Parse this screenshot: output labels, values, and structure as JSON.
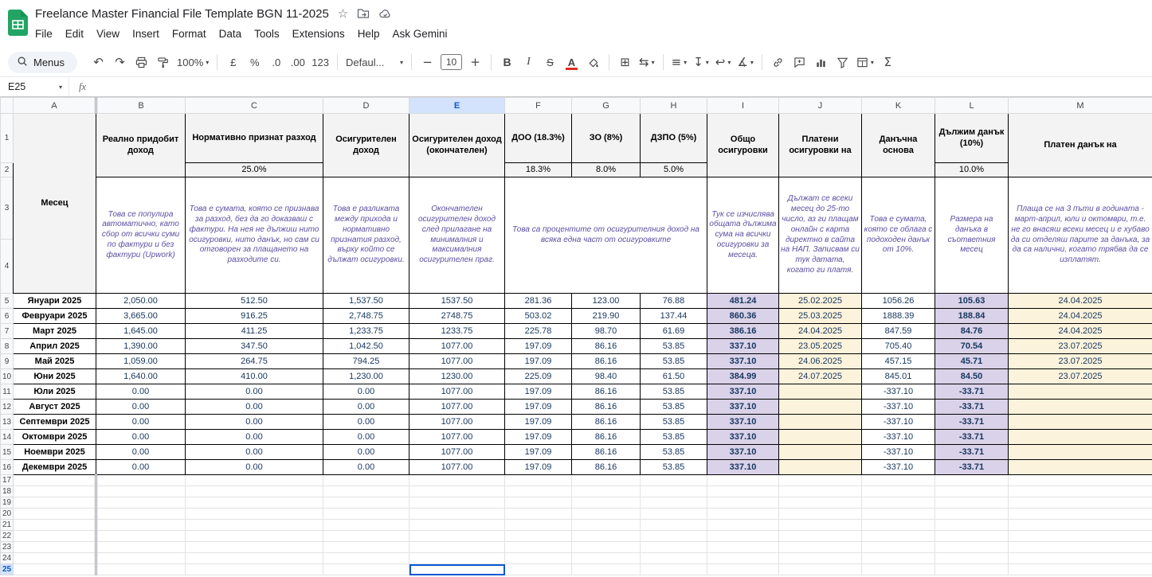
{
  "titlebar": {
    "title": "Freelance Master Financial File Template BGN 11-2025",
    "menus": [
      "File",
      "Edit",
      "View",
      "Insert",
      "Format",
      "Data",
      "Tools",
      "Extensions",
      "Help",
      "Ask Gemini"
    ]
  },
  "toolbar": {
    "menus_label": "Menus",
    "zoom": "100%",
    "currency": "£",
    "percent": "%",
    "decrease_decimal": ".0",
    "increase_decimal": ".00",
    "more_formats": "123",
    "font_name": "Defaul...",
    "font_size": "10"
  },
  "icons": {
    "undo": "↶",
    "redo": "↷",
    "dropdown": "▾",
    "minus": "−",
    "plus": "+",
    "bold": "B",
    "italic": "I",
    "strikethrough": "S",
    "text_color": "A",
    "borders": "⊞",
    "merge": "⇆",
    "align_left": "≡",
    "vertical_align": "↧",
    "text_wrap": "↩",
    "text_rotate": "∡",
    "sigma": "Σ",
    "star": "☆"
  },
  "formula_bar": {
    "cell_ref": "E25",
    "fx_label": "fx"
  },
  "grid": {
    "col_letters": [
      "A",
      "B",
      "C",
      "D",
      "E",
      "F",
      "G",
      "H",
      "I",
      "J",
      "K",
      "L",
      "M"
    ],
    "row_count": 25,
    "selection": {
      "col": "E",
      "row": 25
    },
    "headers": {
      "a": "Месец",
      "b": "Реално придобит доход",
      "c": "Нормативно признат разход",
      "c_pct": "25.0%",
      "d": "Осигурителен доход",
      "e": "Осигурителен доход (окончателен)",
      "f": "ДОО (18.3%)",
      "f_pct": "18.3%",
      "g": "ЗО (8%)",
      "g_pct": "8.0%",
      "h": "ДЗПО (5%)",
      "h_pct": "5.0%",
      "i": "Общо осигуровки",
      "j": "Платени осигуровки на",
      "k": "Данъчна основа",
      "l": "Дължим данък (10%)",
      "l_pct": "10.0%",
      "m": "Платен данък на"
    },
    "descriptions": {
      "b": "Това се популира автоматично, като сбор от всички суми по фактури и без фактури (Upwork)",
      "c": "Това е сумата, която се признава за разход, без да го доказваш с фактури. На нея не дължиш нито осигуровки, нито данък, но сам си отговорен за плащането на разходите си.",
      "d": "Това е разликата между прихода и нормативно признатия разход, върху който се дължат осигуровки.",
      "e": "Окончателен осигурителен доход след прилагане на минималния и максималния осигурителен праг.",
      "fgh": "Това са процентите от осигурителния доход на всяка една част от осигуровките",
      "i": "Тук се изчислява общата дължима сума на всички осигуровки за месеца.",
      "j": "Дължат се всеки месец до 25-то число, аз ги плащам онлайн с карта директно в сайта на НАП. Записвам си тук датата, когато ги платя.",
      "k": "Това е сумата, която се облага с подоходен данък от 10%.",
      "l": "Размера на данъка в съответния месец",
      "m": "Плаща се на 3 пъти в годината - март-април, юли и октомври, т.е. не го внасяш всеки месец и е хубаво да си отделяш парите за данъка, за да са налични, когато трябва да се изплатят."
    },
    "rows": [
      [
        "Януари 2025",
        "2,050.00",
        "512.50",
        "1,537.50",
        "1537.50",
        "281.36",
        "123.00",
        "76.88",
        "481.24",
        "25.02.2025",
        "1056.26",
        "105.63",
        "24.04.2025"
      ],
      [
        "Февруари 2025",
        "3,665.00",
        "916.25",
        "2,748.75",
        "2748.75",
        "503.02",
        "219.90",
        "137.44",
        "860.36",
        "25.03.2025",
        "1888.39",
        "188.84",
        "24.04.2025"
      ],
      [
        "Март 2025",
        "1,645.00",
        "411.25",
        "1,233.75",
        "1233.75",
        "225.78",
        "98.70",
        "61.69",
        "386.16",
        "24.04.2025",
        "847.59",
        "84.76",
        "24.04.2025"
      ],
      [
        "Април 2025",
        "1,390.00",
        "347.50",
        "1,042.50",
        "1077.00",
        "197.09",
        "86.16",
        "53.85",
        "337.10",
        "23.05.2025",
        "705.40",
        "70.54",
        "23.07.2025"
      ],
      [
        "Май 2025",
        "1,059.00",
        "264.75",
        "794.25",
        "1077.00",
        "197.09",
        "86.16",
        "53.85",
        "337.10",
        "24.06.2025",
        "457.15",
        "45.71",
        "23.07.2025"
      ],
      [
        "Юни 2025",
        "1,640.00",
        "410.00",
        "1,230.00",
        "1230.00",
        "225.09",
        "98.40",
        "61.50",
        "384.99",
        "24.07.2025",
        "845.01",
        "84.50",
        "23.07.2025"
      ],
      [
        "Юли 2025",
        "0.00",
        "0.00",
        "0.00",
        "1077.00",
        "197.09",
        "86.16",
        "53.85",
        "337.10",
        "",
        "-337.10",
        "-33.71",
        ""
      ],
      [
        "Август 2025",
        "0.00",
        "0.00",
        "0.00",
        "1077.00",
        "197.09",
        "86.16",
        "53.85",
        "337.10",
        "",
        "-337.10",
        "-33.71",
        ""
      ],
      [
        "Септември 2025",
        "0.00",
        "0.00",
        "0.00",
        "1077.00",
        "197.09",
        "86.16",
        "53.85",
        "337.10",
        "",
        "-337.10",
        "-33.71",
        ""
      ],
      [
        "Октомври 2025",
        "0.00",
        "0.00",
        "0.00",
        "1077.00",
        "197.09",
        "86.16",
        "53.85",
        "337.10",
        "",
        "-337.10",
        "-33.71",
        ""
      ],
      [
        "Ноември 2025",
        "0.00",
        "0.00",
        "0.00",
        "1077.00",
        "197.09",
        "86.16",
        "53.85",
        "337.10",
        "",
        "-337.10",
        "-33.71",
        ""
      ],
      [
        "Декември 2025",
        "0.00",
        "0.00",
        "0.00",
        "1077.00",
        "197.09",
        "86.16",
        "53.85",
        "337.10",
        "",
        "-337.10",
        "-33.71",
        ""
      ]
    ],
    "colors": {
      "purple_fill": "#d9d2e9",
      "yellow_fill": "#fcf3dc",
      "header_fill": "#f3f3f3",
      "desc_text": "#5a4fa2",
      "number_text": "#17365d",
      "selection_blue": "#0b57d0",
      "selected_header_fill": "#d3e3fd"
    }
  }
}
